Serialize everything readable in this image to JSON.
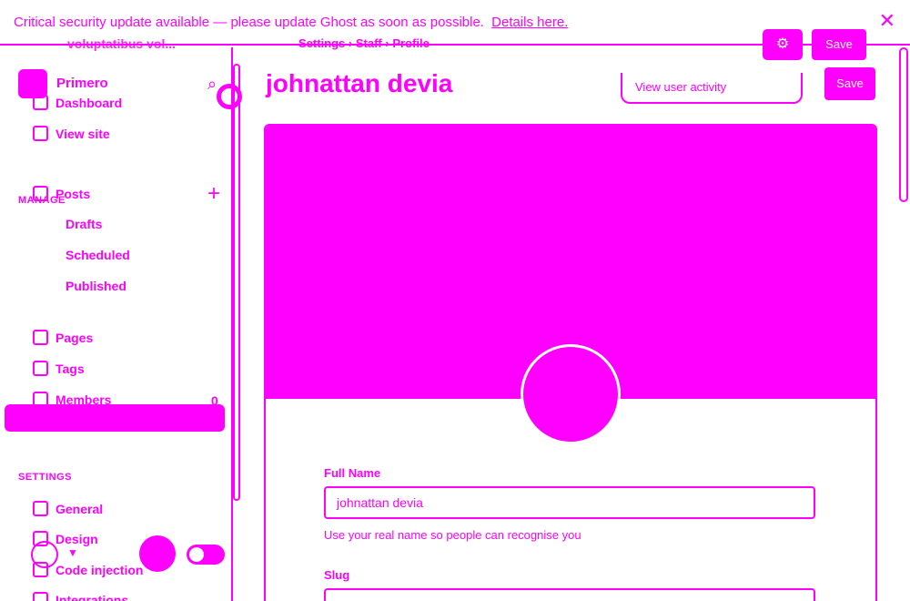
{
  "banner": {
    "message": "Critical security update available — please update Ghost as soon as possible.",
    "link": "Details here."
  },
  "ghost": {
    "site_title": "voluptatibus vol..."
  },
  "sidebar": {
    "site_name": "Primero",
    "nav_top": [
      "Dashboard",
      "View site"
    ],
    "manage_label": "MANAGE",
    "manage_items": [
      "Posts",
      "Drafts",
      "Scheduled",
      "Published",
      "Pages",
      "Tags",
      "Members"
    ],
    "members_count": "0",
    "settings_label": "SETTINGS",
    "settings_items": [
      "General",
      "Design",
      "Code injection",
      "Integrations"
    ]
  },
  "main": {
    "breadcrumb": [
      "Settings",
      "Staff",
      "Profile"
    ],
    "title": "johnattan devia",
    "view_activity": "View user activity",
    "save": "Save",
    "full_name_label": "Full Name",
    "full_name_value": "johnattan devia",
    "full_name_hint": "Use your real name so people can recognise you",
    "slug_label": "Slug"
  },
  "colors": {
    "accent": "#ff00ff"
  }
}
